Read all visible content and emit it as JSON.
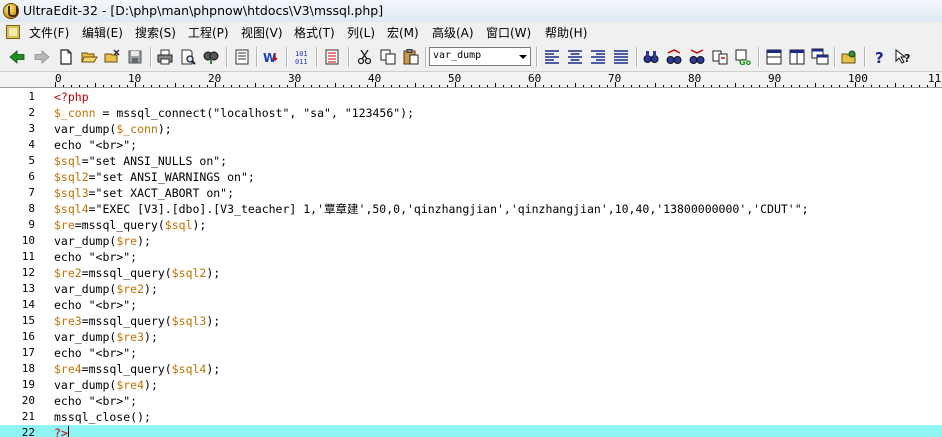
{
  "window": {
    "title": "UltraEdit-32 - [D:\\php\\man\\phpnow\\htdocs\\V3\\mssql.php]"
  },
  "menu": [
    "文件(F)",
    "编辑(E)",
    "搜索(S)",
    "工程(P)",
    "视图(V)",
    "格式(T)",
    "列(L)",
    "宏(M)",
    "高级(A)",
    "窗口(W)",
    "帮助(H)"
  ],
  "toolbar": {
    "function_combo_value": "var_dump"
  },
  "ruler": {
    "labels": [
      "0",
      "10",
      "20",
      "30",
      "40",
      "50",
      "60",
      "70",
      "80",
      "90",
      "100",
      "110"
    ]
  },
  "colors": {
    "keyword_tag": "#c00000",
    "string": "#000000",
    "variable": "#c07000",
    "plain": "#000000",
    "current_line": "#8ff4f4"
  },
  "editor": {
    "current_line": 22,
    "lines": [
      [
        {
          "t": "<?php",
          "c": "red"
        }
      ],
      [
        {
          "t": "$_conn",
          "c": "var"
        },
        {
          "t": " = mssql_connect(\"localhost\", \"sa\", \"123456\");",
          "c": "plain"
        }
      ],
      [
        {
          "t": "var_dump(",
          "c": "plain"
        },
        {
          "t": "$_conn",
          "c": "var"
        },
        {
          "t": ");",
          "c": "plain"
        }
      ],
      [
        {
          "t": "echo \"<br>\";",
          "c": "plain"
        }
      ],
      [
        {
          "t": "$sql",
          "c": "var"
        },
        {
          "t": "=\"set ANSI_NULLS on\";",
          "c": "plain"
        }
      ],
      [
        {
          "t": "$sql2",
          "c": "var"
        },
        {
          "t": "=\"set ANSI_WARNINGS on\";",
          "c": "plain"
        }
      ],
      [
        {
          "t": "$sql3",
          "c": "var"
        },
        {
          "t": "=\"set XACT_ABORT on\";",
          "c": "plain"
        }
      ],
      [
        {
          "t": "$sql4",
          "c": "var"
        },
        {
          "t": "=\"EXEC [V3].[dbo].[V3_teacher] 1,'覃章建',50,0,'qinzhangjian','qinzhangjian',10,40,'13800000000','CDUT'\";",
          "c": "plain"
        }
      ],
      [
        {
          "t": "$re",
          "c": "var"
        },
        {
          "t": "=mssql_query(",
          "c": "plain"
        },
        {
          "t": "$sql",
          "c": "var"
        },
        {
          "t": ");",
          "c": "plain"
        }
      ],
      [
        {
          "t": "var_dump(",
          "c": "plain"
        },
        {
          "t": "$re",
          "c": "var"
        },
        {
          "t": ");",
          "c": "plain"
        }
      ],
      [
        {
          "t": "echo \"<br>\";",
          "c": "plain"
        }
      ],
      [
        {
          "t": "$re2",
          "c": "var"
        },
        {
          "t": "=mssql_query(",
          "c": "plain"
        },
        {
          "t": "$sql2",
          "c": "var"
        },
        {
          "t": ");",
          "c": "plain"
        }
      ],
      [
        {
          "t": "var_dump(",
          "c": "plain"
        },
        {
          "t": "$re2",
          "c": "var"
        },
        {
          "t": ");",
          "c": "plain"
        }
      ],
      [
        {
          "t": "echo \"<br>\";",
          "c": "plain"
        }
      ],
      [
        {
          "t": "$re3",
          "c": "var"
        },
        {
          "t": "=mssql_query(",
          "c": "plain"
        },
        {
          "t": "$sql3",
          "c": "var"
        },
        {
          "t": ");",
          "c": "plain"
        }
      ],
      [
        {
          "t": "var_dump(",
          "c": "plain"
        },
        {
          "t": "$re3",
          "c": "var"
        },
        {
          "t": ");",
          "c": "plain"
        }
      ],
      [
        {
          "t": "echo \"<br>\";",
          "c": "plain"
        }
      ],
      [
        {
          "t": "$re4",
          "c": "var"
        },
        {
          "t": "=mssql_query(",
          "c": "plain"
        },
        {
          "t": "$sql4",
          "c": "var"
        },
        {
          "t": ");",
          "c": "plain"
        }
      ],
      [
        {
          "t": "var_dump(",
          "c": "plain"
        },
        {
          "t": "$re4",
          "c": "var"
        },
        {
          "t": ");",
          "c": "plain"
        }
      ],
      [
        {
          "t": "echo \"<br>\";",
          "c": "plain"
        }
      ],
      [
        {
          "t": "mssql_close();",
          "c": "plain"
        }
      ],
      [
        {
          "t": "?>",
          "c": "red"
        }
      ]
    ]
  }
}
